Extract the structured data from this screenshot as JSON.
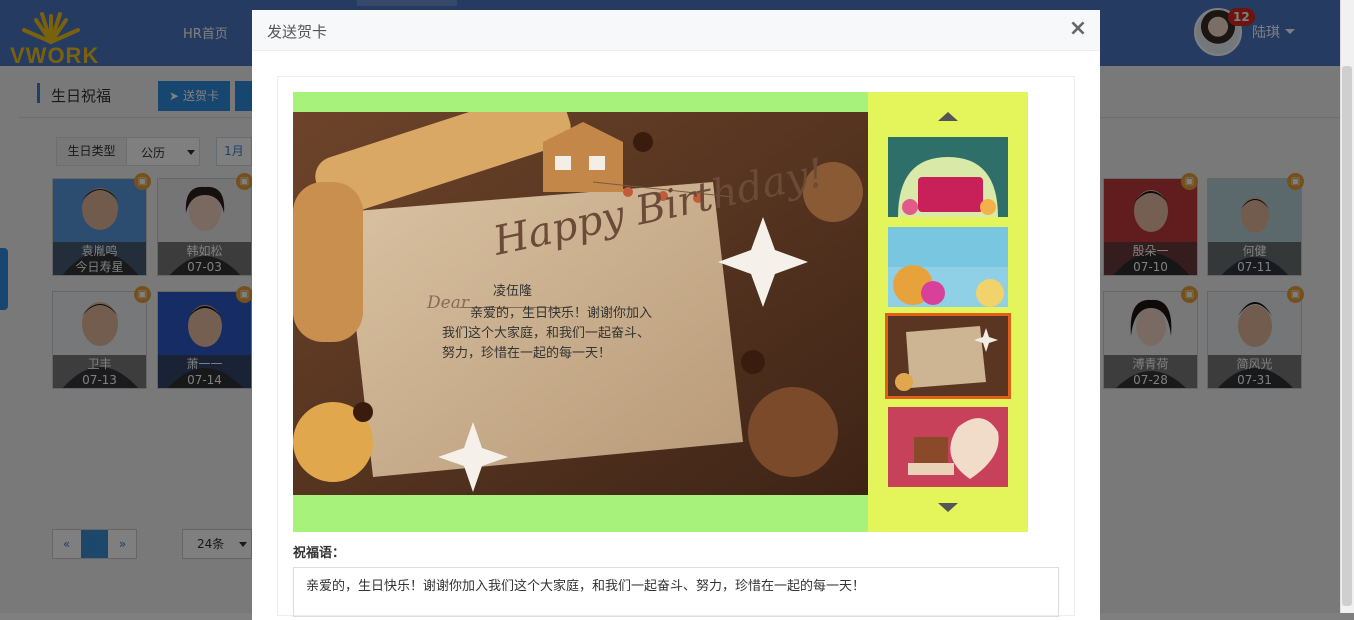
{
  "header": {
    "logo_text": "VWORK",
    "nav_home": "HR首页",
    "user_name": "陆琪",
    "notification_count": "12"
  },
  "page": {
    "title": "生日祝福",
    "send_button": "送贺卡",
    "filter_label": "生日类型",
    "filter_value": "公历",
    "month_tab": "1月",
    "per_page": "24条",
    "pager_prev": "«",
    "pager_current": "1",
    "pager_next": "»"
  },
  "employees": [
    {
      "name": "袁胤鸣",
      "date": "今日寿星"
    },
    {
      "name": "韩如松",
      "date": "07-03"
    },
    {
      "name": "殷朵一",
      "date": "07-10"
    },
    {
      "name": "何健",
      "date": "07-11"
    },
    {
      "name": "卫丰",
      "date": "07-13"
    },
    {
      "name": "萧一一",
      "date": "07-14"
    },
    {
      "name": "溥青荷",
      "date": "07-28"
    },
    {
      "name": "简风光",
      "date": "07-31"
    }
  ],
  "modal": {
    "title": "发送贺卡",
    "close_symbol": "×",
    "card_greeting": "Happy Birthday!",
    "dear_prefix": "Dear",
    "recipient": "凌伍隆",
    "card_message": "亲爱的，生日快乐！谢谢你加入我们这个大家庭，和我们一起奋斗、努力，珍惜在一起的每一天！",
    "blessing_label": "祝福语：",
    "blessing_text": "亲爱的，生日快乐！谢谢你加入我们这个大家庭，和我们一起奋斗、努力，珍惜在一起的每一天！",
    "thumbnails": [
      {
        "name": "green-birthday-card",
        "selected": false
      },
      {
        "name": "blue-cake-card",
        "selected": false
      },
      {
        "name": "cookie-paper-card",
        "selected": true
      },
      {
        "name": "red-cake-card",
        "selected": false
      }
    ]
  },
  "colors": {
    "topbar": "#4a76c4",
    "accent": "#2f8fe0",
    "card_frame": "#a6f27a",
    "thumb_column": "#e3f55a",
    "selection": "#e0601a"
  }
}
